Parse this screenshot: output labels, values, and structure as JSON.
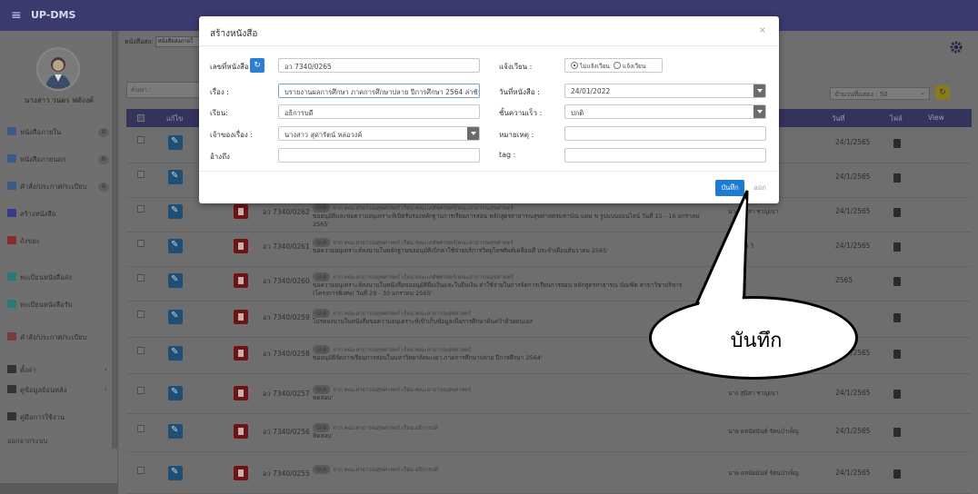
{
  "app": {
    "brand": "UP-DMS"
  },
  "sidebar": {
    "user_name": "นางสาว วนตร ฟดังงต์",
    "items": [
      {
        "label": "หนังสือภายใน",
        "badge": "0",
        "color": "#3a5a8a"
      },
      {
        "label": "หนังสือภายนอก",
        "badge": "0",
        "color": "#3a5a8a"
      },
      {
        "label": "คำสั่ง/ประกาศ/ระเบียบ",
        "badge": "0",
        "color": "#3a5a8a"
      },
      {
        "label": "สร้างหนังสือ",
        "badge": "",
        "color": "#3a3a8a"
      },
      {
        "label": "ถังขยะ",
        "badge": "",
        "color": "#8a2a2a"
      },
      {
        "label": "ทะเบียนหนังสือส่ง",
        "badge": "",
        "color": "#2a7a7a"
      },
      {
        "label": "ทะเบียนหนังสือรับ",
        "badge": "",
        "color": "#2a7a7a"
      },
      {
        "label": "คำสั่ง/ประกาศ/ระเบียบ",
        "badge": "",
        "color": "#7a3a3a"
      },
      {
        "label": "ตั้งค่า",
        "badge": "",
        "color": "#333333"
      },
      {
        "label": "ดูข้อมูลย้อนหลัง",
        "badge": "",
        "color": "#333333"
      },
      {
        "label": "คู่มือการใช้งาน",
        "badge": "",
        "color": "#333333"
      },
      {
        "label": "ออกจากระบบ",
        "badge": "",
        "color": ""
      }
    ]
  },
  "content": {
    "subhead_label": "หนังสือส่ง:",
    "subhead_select": "หนังสือส่งภายใ",
    "search_placeholder": "ค้นหา :",
    "per_page": "จำนวนที่แสดง : 50",
    "headers": {
      "edit": "แก้ไข",
      "date": "วันที่",
      "file": "ไฟล์",
      "view": "View"
    },
    "rows": [
      {
        "docno": "",
        "tag": "",
        "org": "",
        "subject": "",
        "owner": "",
        "date": "24/1/2565"
      },
      {
        "docno": "",
        "tag": "",
        "org": "",
        "subject": "",
        "owner": "",
        "date": "24/1/2565"
      },
      {
        "docno": "อว 7340/0262",
        "tag": "ปกติ",
        "org": "จาก คณะสาธารณสุขศาสตร์ เรียน คณะเภสัชศาสตร์/คณะสาธารณสุขศาสตร์",
        "subject": "ขออนุมัติและขอความอนุเคราะห์เปิดรับรองหลักฐานการเรียนการสอน หลักสูตรสาธารณสุขศาสตรมหาบัณ แผน ข รูปแบบออนไลน์ วันที่ 15 - 16 มกราคม 2565'",
        "owner": "นาง สุนิสา ชาญเนา",
        "date": "24/1/2565"
      },
      {
        "docno": "อว 7340/0261",
        "tag": "ปกติ",
        "org": "จาก คณะสาธารณสุขศาสตร์ เรียน คณะเภสัชศาสตร์/คณะสาธารณสุขศาสตร์",
        "subject": "ขอความอนุเคราะห์ลงนามในหลักฐานขออนุมัติเบิกค่าใช้จ่ายบริการวิทยุโทรศัพท์เคลื่อนที่ ประจำเดือนธันวาคม 2565'",
        "owner": "นางสาว วิ",
        "date": "24/1/2565"
      },
      {
        "docno": "อว 7340/0260",
        "tag": "ปกติ",
        "org": "จาก คณะสาธารณสุขศาสตร์ เรียน คณะเภสัชศาสตร์/คณะสาธารณสุขศาสตร์",
        "subject": "ขอความอนุเคราะห์ลงนามในหนังสือขออนุมัติยืมเงินและใบยืมเงิน ค่าใช้จ่ายในการจัดการเรียนการสอน หลักสูตรสาธารณ บัณฑิต สาขาวิชาบริหาร (โครงการพิเศษ) วันที่ 29 - 30 มกราคม 2565'",
        "owner": "",
        "date": "2565"
      },
      {
        "docno": "อว 7340/0259",
        "tag": "ปกติ",
        "org": "จาก คณะสาธารณสุขศาสตร์ เรียน คณะสาธารณสุขศาสตร์",
        "subject": "โปรดลงนามในหนังสือขอความอนุเคราะห์เข้าเก็บข้อมูลเพื่อการศึกษาค้นคว้าด้วยตนเอง'",
        "owner": "",
        "date": ""
      },
      {
        "docno": "อว 7340/0258",
        "tag": "ปกติ",
        "org": "จาก คณะสาธารณสุขศาสตร์ เรียน คณะสาธารณสุขศาสตร์",
        "subject": "ขออนุมัติจัดการเรียนการสอนในมหาวิทยาลัยพะเยา ภาคการศึกษาปลาย ปีการศึกษา 2564'",
        "owner": "",
        "date": "24/1/2565"
      },
      {
        "docno": "อว 7340/0257",
        "tag": "ปกติ",
        "org": "จาก คณะสาธารณสุขศาสตร์ เรียน คณะสาธารณสุขศาสตร์",
        "subject": "ทดสอบ'",
        "owner": "นาง สุนิสา ชาญเนา",
        "date": "24/1/2565"
      },
      {
        "docno": "อว 7340/0256",
        "tag": "ปกติ",
        "org": "จาก คณะสาธารณสุขศาสตร์ เรียน อธิการบดี",
        "subject": "ทิดสอบ'",
        "owner": "นาย ดลนัยนันท์ รัตนบำเพ็ญ",
        "date": "24/1/2565"
      },
      {
        "docno": "อว 7340/0255",
        "tag": "ปกติ",
        "org": "จาก คณะสาธารณสุขศาสตร์ เรียน อธิการบดี",
        "subject": "",
        "owner": "นาย ดลนัยนันท์ รัตนบำเพ็ญ",
        "date": "24/1/2565"
      }
    ]
  },
  "modal": {
    "title": "สร้างหนังสือ",
    "close": "×",
    "fields": {
      "docno_label": "เลขที่หนังสือ",
      "docno_value": "อว 7340/0265",
      "subject_label": "เรื่อง :",
      "subject_value": "บรายงานผลการศึกษา ภาคการศึกษาปลาย ปีการศึกษา 2564 ล่าช้า",
      "to_label": "เรียน:",
      "to_value": "อธิการบดี",
      "owner_label": "เจ้าของเรื่อง :",
      "owner_value": "นางสาว สุดารัตน์ หล่อวงค์",
      "ref_label": "อ้างถึง",
      "ref_value": "",
      "circulate_label": "แจ้งเวียน :",
      "radio_no": "ไม่แจ้งเวียน",
      "radio_yes": "แจ้งเวียน",
      "date_label": "วันที่หนังสือ :",
      "date_value": "24/01/2022",
      "urgency_label": "ชั้นความเร็ว :",
      "urgency_value": "ปกติ",
      "note_label": "หมายเหตุ :",
      "note_value": "",
      "tag_label": "tag :",
      "tag_value": ""
    },
    "save_label": "บันทึก",
    "cancel_label": "ออก"
  },
  "annotation": {
    "callout_text": "บันทึก"
  }
}
